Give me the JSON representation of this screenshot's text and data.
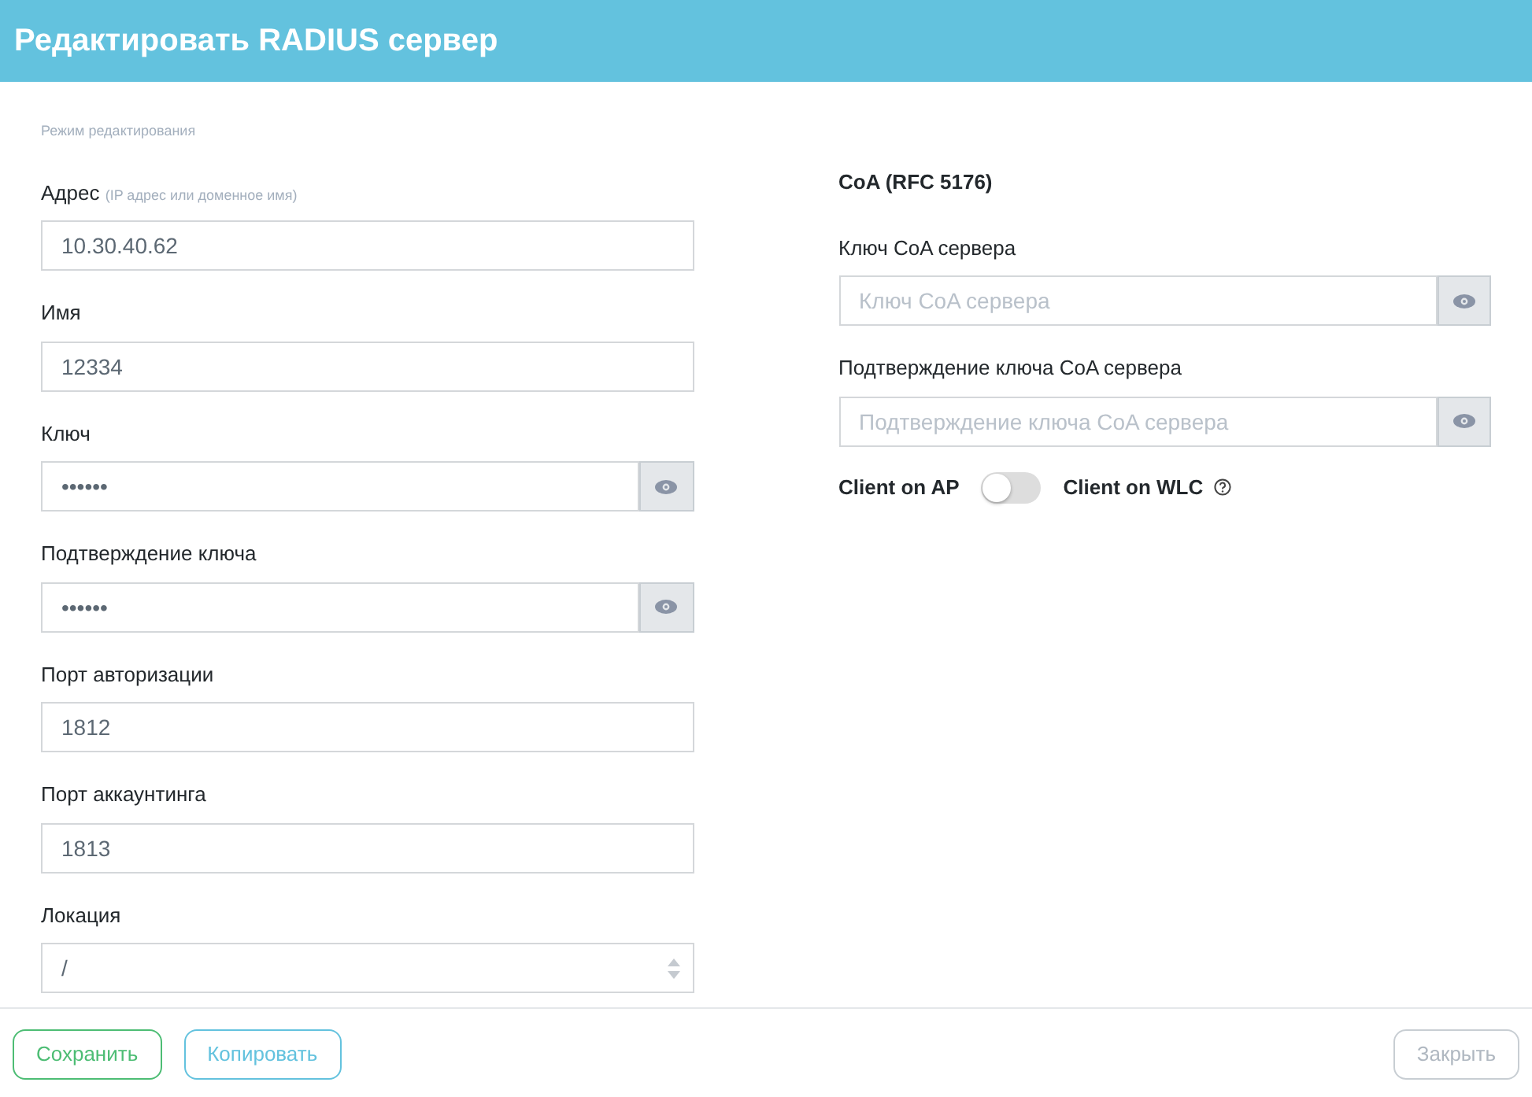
{
  "window": {
    "title": "Редактировать RADIUS сервер"
  },
  "mode_label": "Режим редактирования",
  "left_fields": [
    {
      "kind": "text",
      "label": "Адрес",
      "hint": "(IP адрес или доменное имя)",
      "value": "10.30.40.62"
    },
    {
      "kind": "text",
      "label": "Имя",
      "value": "12334"
    },
    {
      "kind": "password",
      "label": "Ключ",
      "value": "••••••"
    },
    {
      "kind": "password",
      "label": "Подтверждение ключа",
      "value": "••••••"
    },
    {
      "kind": "text",
      "label": "Порт авторизации",
      "value": "1812"
    },
    {
      "kind": "text",
      "label": "Порт аккаунтинга",
      "value": "1813"
    },
    {
      "kind": "select",
      "label": "Локация",
      "value": "/"
    }
  ],
  "coa": {
    "title": "CoA (RFC 5176)",
    "fields": [
      {
        "kind": "password",
        "label": "Ключ CoA сервера",
        "placeholder": "Ключ CoA сервера"
      },
      {
        "kind": "password",
        "label": "Подтверждение ключа CoA сервера",
        "placeholder": "Подтверждение ключа CoA сервера"
      }
    ],
    "toggle": {
      "left_label": "Client on AP",
      "right_label": "Client on WLC",
      "on": false
    }
  },
  "buttons": [
    {
      "label": "Сохранить",
      "kind": "success",
      "disabled": false
    },
    {
      "label": "Копировать",
      "kind": "info",
      "disabled": false
    },
    {
      "label": "Закрыть",
      "kind": "secondary",
      "disabled": true
    }
  ]
}
